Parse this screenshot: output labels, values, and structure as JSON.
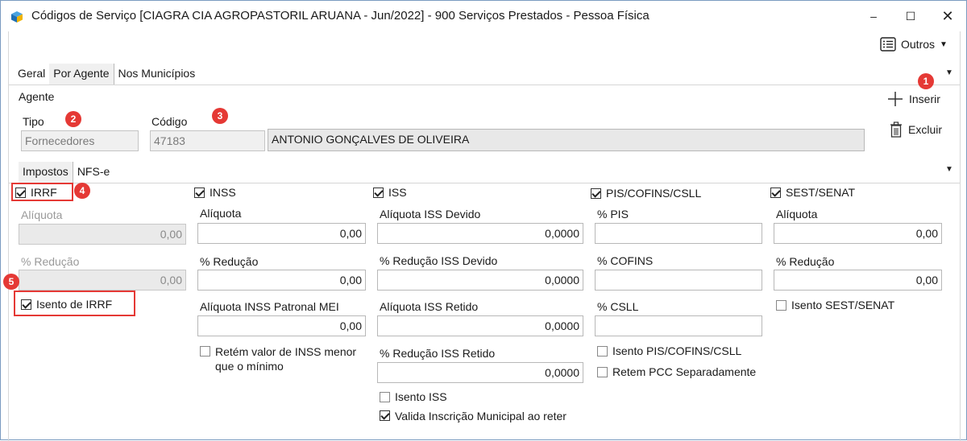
{
  "window": {
    "title": "Códigos de Serviço [CIAGRA CIA AGROPASTORIL ARUANA - Jun/2022]  - 900 Serviços Prestados - Pessoa Física",
    "minimize": "–",
    "maximize": "☐",
    "close": "✕"
  },
  "toolbar": {
    "outros": "Outros"
  },
  "tabs_main": [
    "Geral",
    "Por Agente",
    "Nos Municípios"
  ],
  "agente": {
    "section": "Agente",
    "tipo_label": "Tipo",
    "tipo_value": "Fornecedores",
    "codigo_label": "Código",
    "codigo_value": "47183",
    "nome_value": "ANTONIO GONÇALVES DE OLIVEIRA"
  },
  "actions": {
    "inserir": "Inserir",
    "excluir": "Excluir"
  },
  "tabs_sub": [
    "Impostos",
    "NFS-e"
  ],
  "badges": [
    "1",
    "2",
    "3",
    "4",
    "5"
  ],
  "irrf": {
    "label": "IRRF",
    "aliquota_label": "Alíquota",
    "aliquota_value": "0,00",
    "reducao_label": "% Redução",
    "reducao_value": "0,00",
    "isento_label": "Isento de IRRF"
  },
  "inss": {
    "label": "INSS",
    "aliquota_label": "Alíquota",
    "aliquota_value": "0,00",
    "reducao_label": "% Redução",
    "reducao_value": "0,00",
    "patronal_label": "Alíquota INSS Patronal MEI",
    "patronal_value": "0,00",
    "retem_label": "Retém valor de INSS menor que o mínimo"
  },
  "iss": {
    "label": "ISS",
    "devido_label": "Alíquota ISS Devido",
    "devido_value": "0,0000",
    "red_devido_label": "% Redução ISS Devido",
    "red_devido_value": "0,0000",
    "retido_label": "Alíquota ISS Retido",
    "retido_value": "0,0000",
    "red_retido_label": "% Redução ISS Retido",
    "red_retido_value": "0,0000",
    "isento_label": "Isento ISS",
    "valida_label": "Valida Inscrição Municipal ao reter"
  },
  "pcc": {
    "label": "PIS/COFINS/CSLL",
    "pis_label": "% PIS",
    "pis_value": "",
    "cofins_label": "%  COFINS",
    "cofins_value": "",
    "csll_label": "% CSLL",
    "csll_value": "",
    "isento_label": "Isento PIS/COFINS/CSLL",
    "separado_label": "Retem PCC Separadamente"
  },
  "sest": {
    "label": "SEST/SENAT",
    "aliquota_label": "Alíquota",
    "aliquota_value": "0,00",
    "reducao_label": "% Redução",
    "reducao_value": "0,00",
    "isento_label": "Isento SEST/SENAT"
  },
  "colors": {
    "badge": "#e53935",
    "highlight": "#e53935",
    "window_border": "#7a9bc0"
  }
}
